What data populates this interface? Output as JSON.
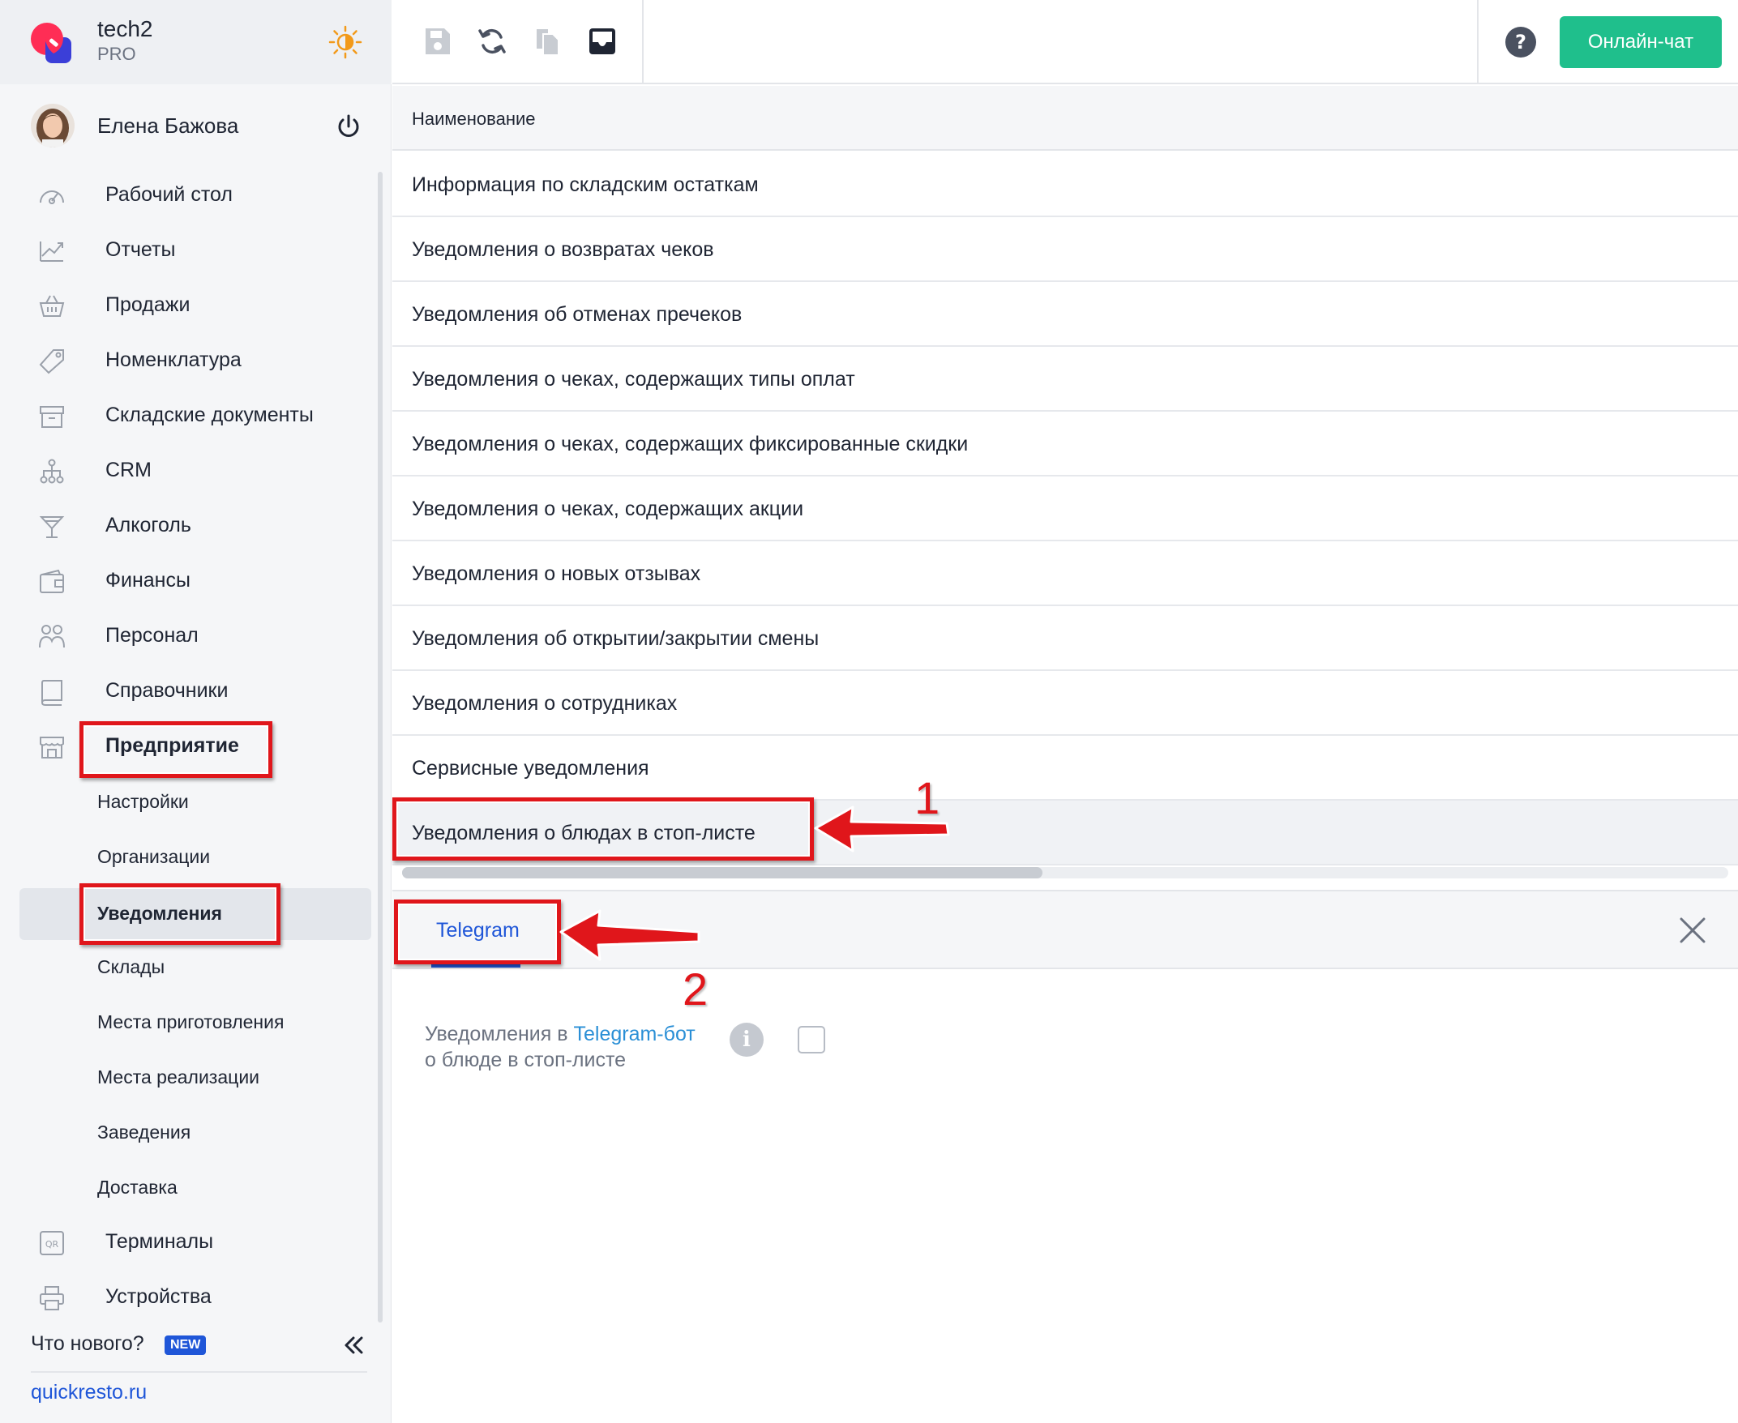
{
  "brand": {
    "name": "tech2",
    "plan": "PRO"
  },
  "user": {
    "name": "Елена Бажова"
  },
  "nav": {
    "items": [
      {
        "label": "Рабочий стол",
        "icon": "dashboard-icon"
      },
      {
        "label": "Отчеты",
        "icon": "chart-icon"
      },
      {
        "label": "Продажи",
        "icon": "basket-icon"
      },
      {
        "label": "Номенклатура",
        "icon": "tag-icon"
      },
      {
        "label": "Складские документы",
        "icon": "archive-icon"
      },
      {
        "label": "CRM",
        "icon": "hierarchy-icon"
      },
      {
        "label": "Алкоголь",
        "icon": "cocktail-icon"
      },
      {
        "label": "Финансы",
        "icon": "wallet-icon"
      },
      {
        "label": "Персонал",
        "icon": "people-icon"
      },
      {
        "label": "Справочники",
        "icon": "book-icon"
      },
      {
        "label": "Предприятие",
        "icon": "store-icon"
      }
    ],
    "subitems": [
      {
        "label": "Настройки"
      },
      {
        "label": "Организации"
      },
      {
        "label": "Уведомления"
      },
      {
        "label": "Склады"
      },
      {
        "label": "Места приготовления"
      },
      {
        "label": "Места реализации"
      },
      {
        "label": "Заведения"
      },
      {
        "label": "Доставка"
      }
    ],
    "bottom_items": [
      {
        "label": "Терминалы",
        "icon": "qr-icon"
      },
      {
        "label": "Устройства",
        "icon": "printer-icon"
      }
    ]
  },
  "footer": {
    "whats_new": "Что нового?",
    "new_badge": "NEW",
    "site": "quickresto.ru"
  },
  "toolbar": {
    "chat_label": "Онлайн-чат"
  },
  "table": {
    "column": "Наименование",
    "rows": [
      "Информация по складским остаткам",
      "Уведомления о возвратах чеков",
      "Уведомления об отменах пречеков",
      "Уведомления о чеках, содержащих типы оплат",
      "Уведомления о чеках, содержащих фиксированные скидки",
      "Уведомления о чеках, содержащих акции",
      "Уведомления о новых отзывах",
      "Уведомления об открытии/закрытии смены",
      "Уведомления о сотрудниках",
      "Сервисные уведомления",
      "Уведомления о блюдах в стоп-листе"
    ]
  },
  "detail": {
    "tab": "Telegram",
    "setting_prefix": "Уведомления в ",
    "setting_link": "Telegram-бот",
    "setting_line2": "о блюде в стоп-листе",
    "info": "i"
  },
  "annotations": {
    "marker1": "1",
    "marker2": "2"
  },
  "colors": {
    "accent": "#1f56d8",
    "chat": "#1fbf8c",
    "highlight": "#e0161b"
  }
}
